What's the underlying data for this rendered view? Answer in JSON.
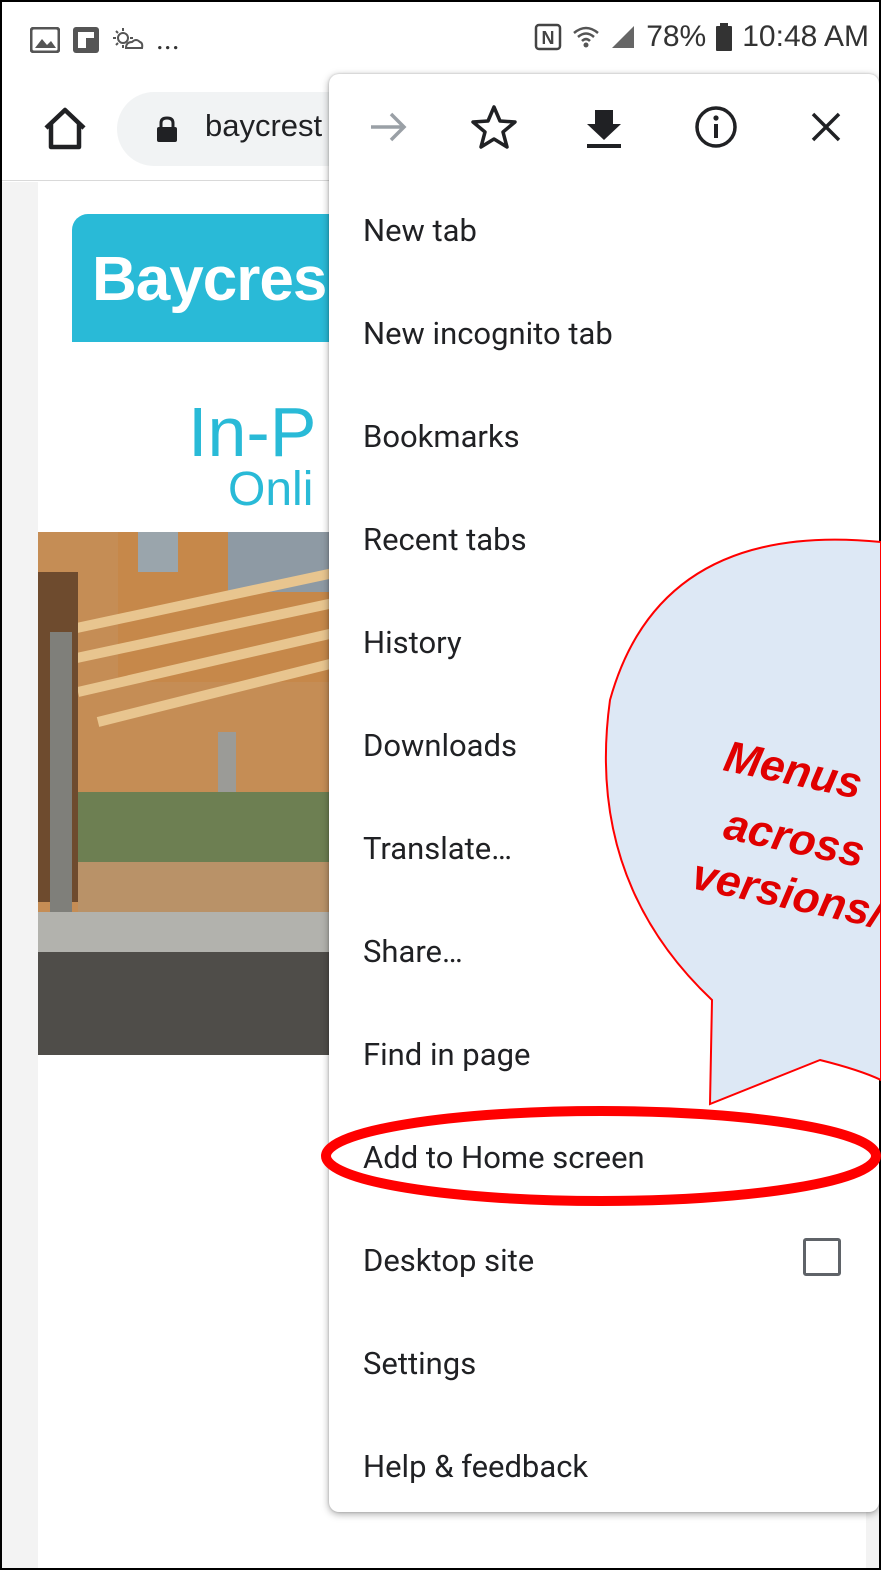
{
  "status_bar": {
    "left_more": "...",
    "battery": "78%",
    "time": "10:48 AM"
  },
  "toolbar": {
    "url": "baycrest"
  },
  "page": {
    "logo": "Baycres",
    "heading1": "In-P",
    "heading2": "Onli"
  },
  "menu": {
    "items": [
      {
        "label": "New tab"
      },
      {
        "label": "New incognito tab"
      },
      {
        "label": "Bookmarks"
      },
      {
        "label": "Recent tabs"
      },
      {
        "label": "History"
      },
      {
        "label": "Downloads"
      },
      {
        "label": "Translate…"
      },
      {
        "label": "Share…"
      },
      {
        "label": "Find in page"
      },
      {
        "label": "Add to Home screen"
      },
      {
        "label": "Desktop site",
        "checkbox": false
      },
      {
        "label": "Settings"
      },
      {
        "label": "Help & feedback"
      }
    ]
  },
  "annotation": {
    "line1": "Menus",
    "line2": "across",
    "line3": "versions/",
    "bubble_color": "#dde8f5",
    "stroke_color": "#ff0000"
  }
}
